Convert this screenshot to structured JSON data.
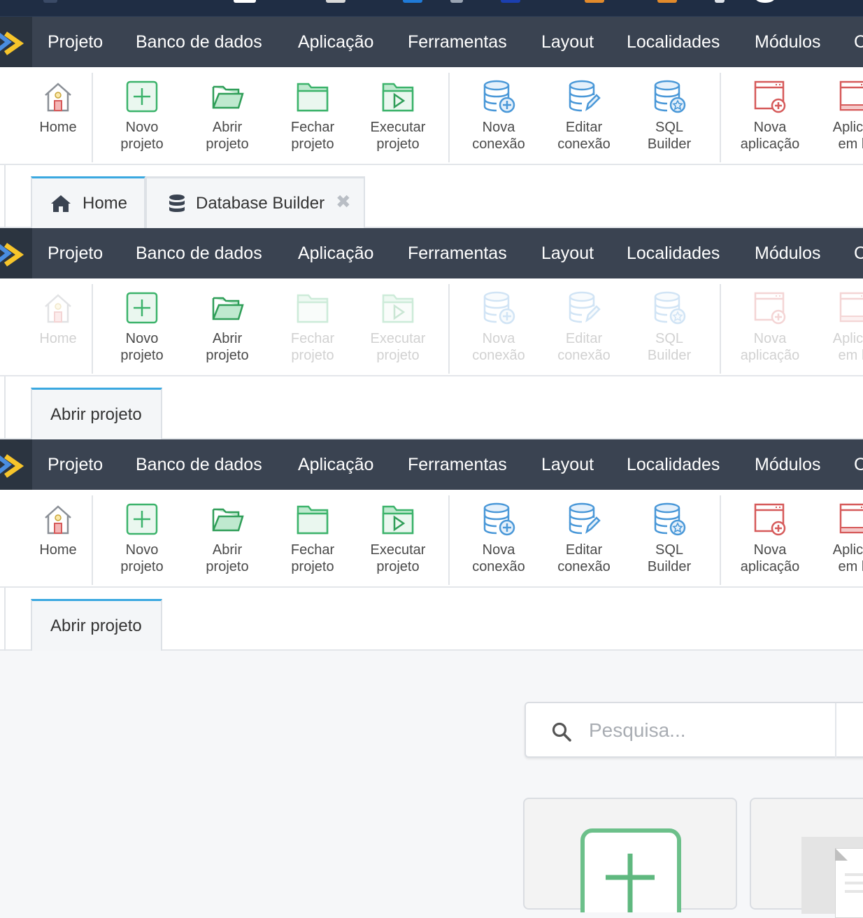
{
  "colors": {
    "menubar_bg": "#3a4351",
    "logo_yellow": "#f7c52b",
    "logo_blue": "#4a8de0",
    "green": "#3cb36b",
    "blue": "#4a98d8",
    "red": "#d65a5a",
    "tab_active_border": "#3aa8e0"
  },
  "menu": {
    "items": [
      "Projeto",
      "Banco de dados",
      "Aplicação",
      "Ferramentas",
      "Layout",
      "Localidades",
      "Módulos",
      "C"
    ]
  },
  "toolbar": {
    "home": "Home",
    "new_project": "Novo\nprojeto",
    "open_project": "Abrir\nprojeto",
    "close_project": "Fechar\nprojeto",
    "run_project": "Executar\nprojeto",
    "new_connection": "Nova\nconexão",
    "edit_connection": "Editar\nconexão",
    "sql_builder": "SQL\nBuilder",
    "new_application": "Nova\naplicação",
    "local_application": "Aplicaç\nem lo"
  },
  "tabs_1": {
    "home": "Home",
    "database_builder": "Database Builder",
    "close_icon": "✖"
  },
  "tabs_2": {
    "open_project": "Abrir projeto"
  },
  "tabs_3": {
    "open_project": "Abrir projeto"
  },
  "search": {
    "placeholder": "Pesquisa..."
  },
  "icons": {
    "home": "home-icon",
    "new_project": "plus-square-icon",
    "open_project": "folder-open-icon",
    "close_project": "folder-icon",
    "run_project": "folder-play-icon",
    "new_connection": "database-plus-icon",
    "edit_connection": "database-edit-icon",
    "sql_builder": "database-star-icon",
    "new_application": "window-plus-icon",
    "local_application": "window-icon",
    "search": "search-icon"
  }
}
